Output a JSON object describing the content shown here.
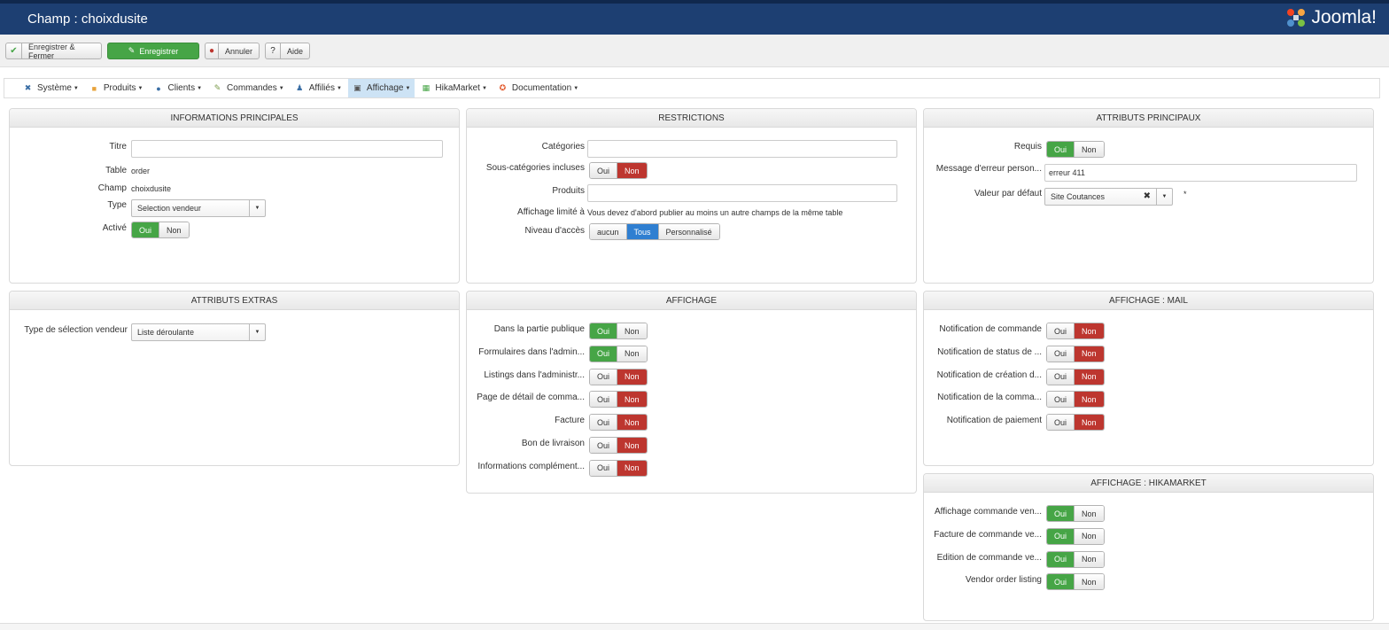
{
  "header": {
    "title": "Champ : choixdusite",
    "logo_text": "Joomla!",
    "logo_icon": "joomla-logo-icon"
  },
  "toolbar": {
    "save_close": "Enregistrer & Fermer",
    "save": "Enregistrer",
    "cancel": "Annuler",
    "help": "Aide"
  },
  "menu": {
    "items": [
      {
        "label": "Système",
        "icon": "tools-icon"
      },
      {
        "label": "Produits",
        "icon": "box-icon"
      },
      {
        "label": "Clients",
        "icon": "users-icon"
      },
      {
        "label": "Commandes",
        "icon": "orders-icon"
      },
      {
        "label": "Affiliés",
        "icon": "affiliates-icon"
      },
      {
        "label": "Affichage",
        "icon": "display-icon"
      },
      {
        "label": "HikaMarket",
        "icon": "hikamarket-icon"
      },
      {
        "label": "Documentation",
        "icon": "lifebuoy-icon"
      }
    ]
  },
  "common": {
    "oui": "Oui",
    "non": "Non"
  },
  "main_info": {
    "heading": "INFORMATIONS PRINCIPALES",
    "titre_label": "Titre",
    "titre_value": "",
    "table_label": "Table",
    "table_value": "order",
    "champ_label": "Champ",
    "champ_value": "choixdusite",
    "type_label": "Type",
    "type_value": "Selection vendeur",
    "active_label": "Activé"
  },
  "restrictions": {
    "heading": "RESTRICTIONS",
    "categories_label": "Catégories",
    "subcat_label": "Sous-catégories incluses",
    "produits_label": "Produits",
    "affichage_label": "Affichage limité à",
    "affichage_value": "Vous devez d'abord publier au moins un autre champs de la même table",
    "niveau_label": "Niveau d'accès",
    "niveau_options": [
      "aucun",
      "Tous",
      "Personnalisé"
    ]
  },
  "attributs": {
    "heading": "ATTRIBUTS PRINCIPAUX",
    "requis_label": "Requis",
    "message_label": "Message d'erreur person...",
    "message_value": "erreur 411",
    "defaut_label": "Valeur par défaut",
    "defaut_value": "Site Coutances",
    "asterisk": "*"
  },
  "extras": {
    "heading": "ATTRIBUTS EXTRAS",
    "type_sel_label": "Type de sélection vendeur",
    "type_sel_value": "Liste déroulante"
  },
  "affichage": {
    "heading": "AFFICHAGE",
    "rows": [
      {
        "label": "Dans la partie publique",
        "on": "oui"
      },
      {
        "label": "Formulaires dans l'admin...",
        "on": "oui"
      },
      {
        "label": "Listings dans l'administr...",
        "on": "non"
      },
      {
        "label": "Page de détail de comma...",
        "on": "non"
      },
      {
        "label": "Facture",
        "on": "non"
      },
      {
        "label": "Bon de livraison",
        "on": "non"
      },
      {
        "label": "Informations complément...",
        "on": "non"
      }
    ]
  },
  "mail": {
    "heading": "AFFICHAGE : MAIL",
    "rows": [
      {
        "label": "Notification de commande",
        "on": "non"
      },
      {
        "label": "Notification de status de ...",
        "on": "non"
      },
      {
        "label": "Notification de création d...",
        "on": "non"
      },
      {
        "label": "Notification de la comma...",
        "on": "non"
      },
      {
        "label": "Notification de paiement",
        "on": "non"
      }
    ]
  },
  "hikamarket": {
    "heading": "AFFICHAGE : HIKAMARKET",
    "rows": [
      {
        "label": "Affichage commande ven...",
        "on": "oui"
      },
      {
        "label": "Facture de commande ve...",
        "on": "oui"
      },
      {
        "label": "Edition de commande ve...",
        "on": "oui"
      },
      {
        "label": "Vendor order listing",
        "on": "oui"
      }
    ]
  },
  "colors": {
    "header": "#1d3f72",
    "green": "#46a546",
    "red": "#bd362f",
    "blue": "#2f7fd1"
  }
}
